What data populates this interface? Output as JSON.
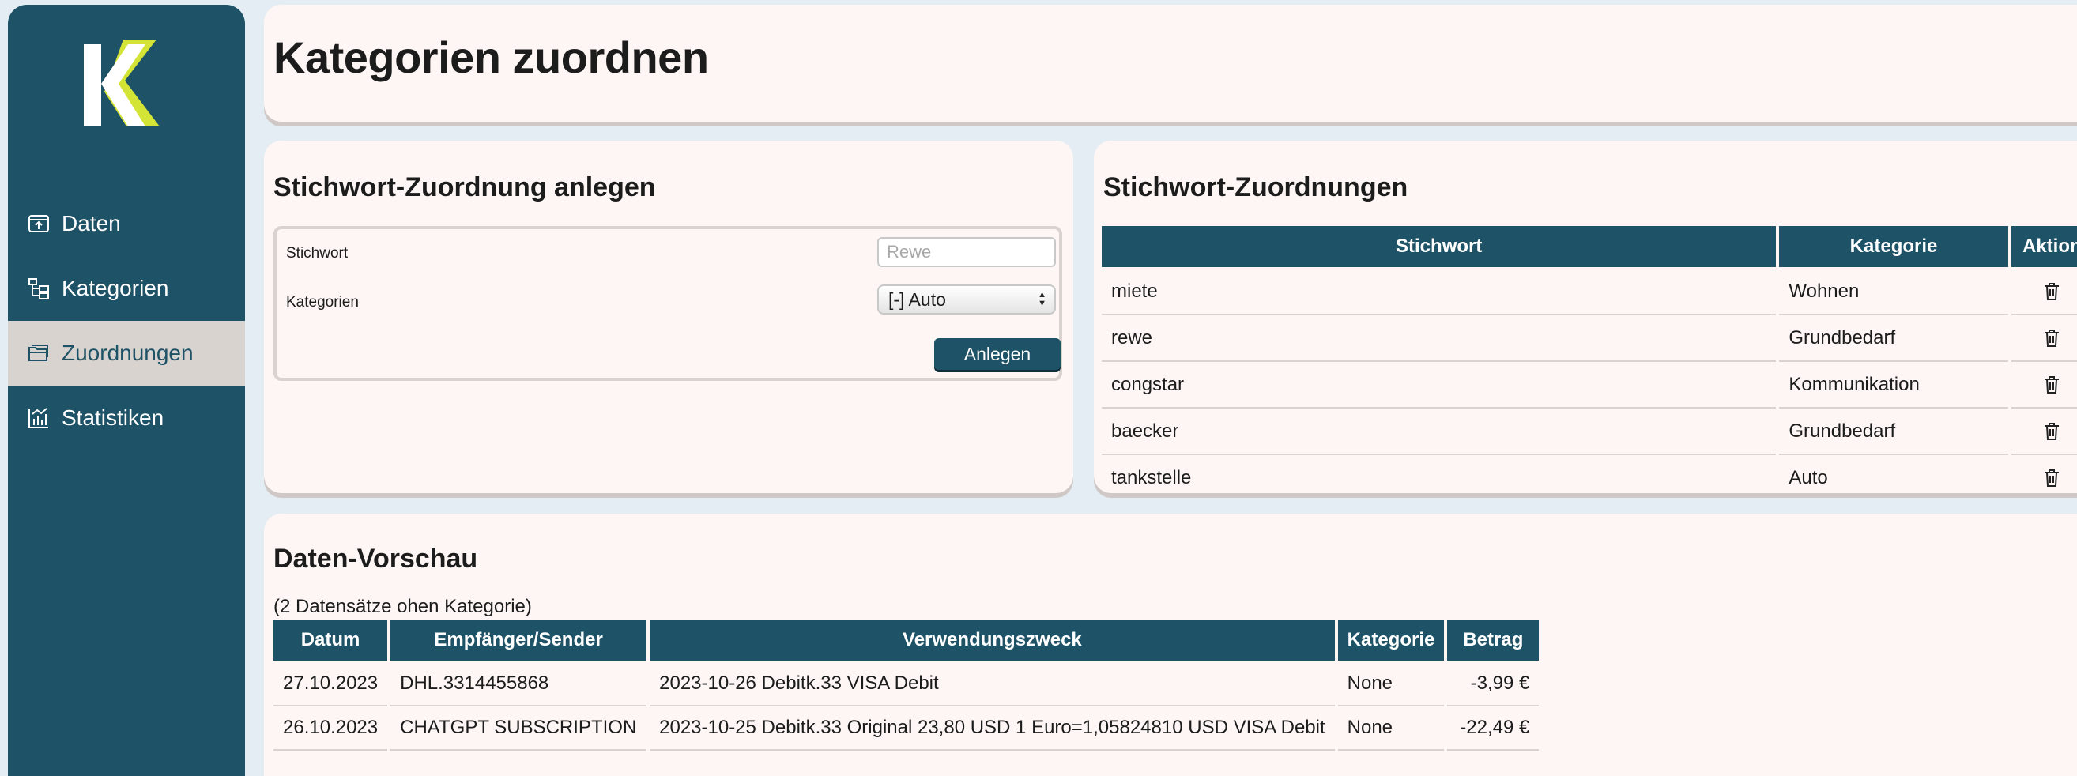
{
  "sidebar": {
    "logo": "KK",
    "items": [
      {
        "label": "Daten",
        "icon": "data-icon"
      },
      {
        "label": "Kategorien",
        "icon": "category-tree-icon"
      },
      {
        "label": "Zuordnungen",
        "icon": "folders-icon",
        "active": true
      },
      {
        "label": "Statistiken",
        "icon": "chart-icon"
      }
    ]
  },
  "header": {
    "title": "Kategorien zuordnen"
  },
  "form": {
    "title": "Stichwort-Zuordnung anlegen",
    "keyword_label": "Stichwort",
    "keyword_placeholder": "Rewe",
    "category_label": "Kategorien",
    "category_selected": "[-] Auto",
    "submit_label": "Anlegen"
  },
  "mappings": {
    "title": "Stichwort-Zuordnungen",
    "columns": [
      "Stichwort",
      "Kategorie",
      "Aktion"
    ],
    "rows": [
      {
        "keyword": "miete",
        "category": "Wohnen"
      },
      {
        "keyword": "rewe",
        "category": "Grundbedarf"
      },
      {
        "keyword": "congstar",
        "category": "Kommunikation"
      },
      {
        "keyword": "baecker",
        "category": "Grundbedarf"
      },
      {
        "keyword": "tankstelle",
        "category": "Auto"
      }
    ]
  },
  "preview": {
    "title": "Daten-Vorschau",
    "count_text": "(2 Datensätze ohen Kategorie)",
    "columns": [
      "Datum",
      "Empfänger/Sender",
      "Verwendungszweck",
      "Kategorie",
      "Betrag"
    ],
    "rows": [
      {
        "date": "27.10.2023",
        "party": "DHL.3314455868",
        "purpose": "2023-10-26 Debitk.33 VISA Debit",
        "category": "None",
        "amount": "-3,99 €"
      },
      {
        "date": "26.10.2023",
        "party": "CHATGPT SUBSCRIPTION",
        "purpose": "2023-10-25 Debitk.33 Original 23,80 USD 1 Euro=1,05824810 USD VISA Debit",
        "category": "None",
        "amount": "-22,49 €"
      }
    ]
  },
  "colors": {
    "primary": "#1e5266",
    "card": "#fdf6f4",
    "background": "#e3edf3",
    "logo_white": "#ffffff",
    "logo_accent": "#d4e436",
    "active_nav": "#d9d3d0"
  }
}
